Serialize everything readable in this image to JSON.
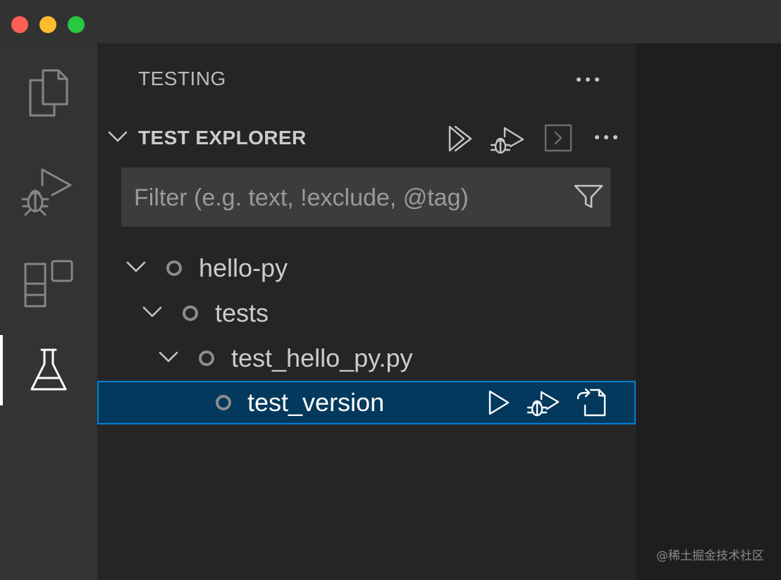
{
  "window": {
    "traffic_lights": {
      "close": "#fe5f57",
      "minimize": "#febc2e",
      "zoom": "#28c840"
    }
  },
  "activity_bar": {
    "items": [
      {
        "icon": "files-icon",
        "active": false
      },
      {
        "icon": "run-debug-icon",
        "active": false
      },
      {
        "icon": "extensions-icon",
        "active": false
      },
      {
        "icon": "testing-flask-icon",
        "active": true
      }
    ]
  },
  "sidebar": {
    "title": "TESTING",
    "more_icon": "ellipsis-icon",
    "section": {
      "title": "TEST EXPLORER",
      "toolbar": [
        "run-all-tests-icon",
        "debug-all-tests-icon",
        "show-output-icon",
        "ellipsis-icon"
      ]
    },
    "filter": {
      "value": "",
      "placeholder": "Filter (e.g. text, !exclude, @tag)",
      "icon": "filter-icon"
    },
    "tree": [
      {
        "label": "hello-py",
        "expanded": true,
        "status": "not-run"
      },
      {
        "label": "tests",
        "expanded": true,
        "status": "not-run"
      },
      {
        "label": "test_hello_py.py",
        "expanded": true,
        "status": "not-run"
      },
      {
        "label": "test_version",
        "selected": true,
        "status": "not-run",
        "actions": [
          "run-test-icon",
          "debug-test-icon",
          "go-to-test-icon"
        ]
      }
    ]
  },
  "watermark": "@稀土掘金技术社区",
  "colors": {
    "selection_bg": "#04395e",
    "selection_border": "#007fd4",
    "sidebar_bg": "#252526",
    "activity_bg": "#333333"
  }
}
